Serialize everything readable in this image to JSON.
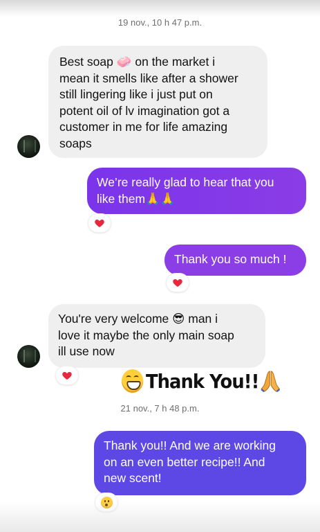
{
  "thread": {
    "timestamp_1": "19 nov., 10 h 47 p.m.",
    "timestamp_2": "21 nov., 7 h 48 p.m."
  },
  "messages": [
    {
      "from": "customer",
      "text_lines": [
        "Best soap 🧼 on the market i",
        "mean it smells like after a shower",
        "still lingering like i just put on",
        "potent oil of lv imagination got a",
        "customer in me for life amazing",
        "soaps"
      ]
    },
    {
      "from": "shop",
      "text_lines": [
        "We’re really glad to hear that you",
        "like them🙏🙏"
      ],
      "reaction": "heart"
    },
    {
      "from": "shop",
      "text_lines": [
        "Thank you so much !"
      ],
      "reaction": "heart"
    },
    {
      "from": "customer",
      "text_lines": [
        "You're very welcome 😎 man i",
        "love it maybe the only main soap",
        "ill use now"
      ],
      "reaction": "heart"
    },
    {
      "from": "customer",
      "sticker_text": "Thank You!!"
    },
    {
      "from": "shop",
      "text_lines": [
        "Thank you!! And we are working",
        "on an even better recipe!! And",
        "new scent!"
      ],
      "reaction": "surprised-face"
    }
  ],
  "colors": {
    "incoming_bubble": "#efefef",
    "outgoing_purple": "#8b3ee6",
    "outgoing_blue": "#5d48e6",
    "heart": "#e8283f"
  }
}
